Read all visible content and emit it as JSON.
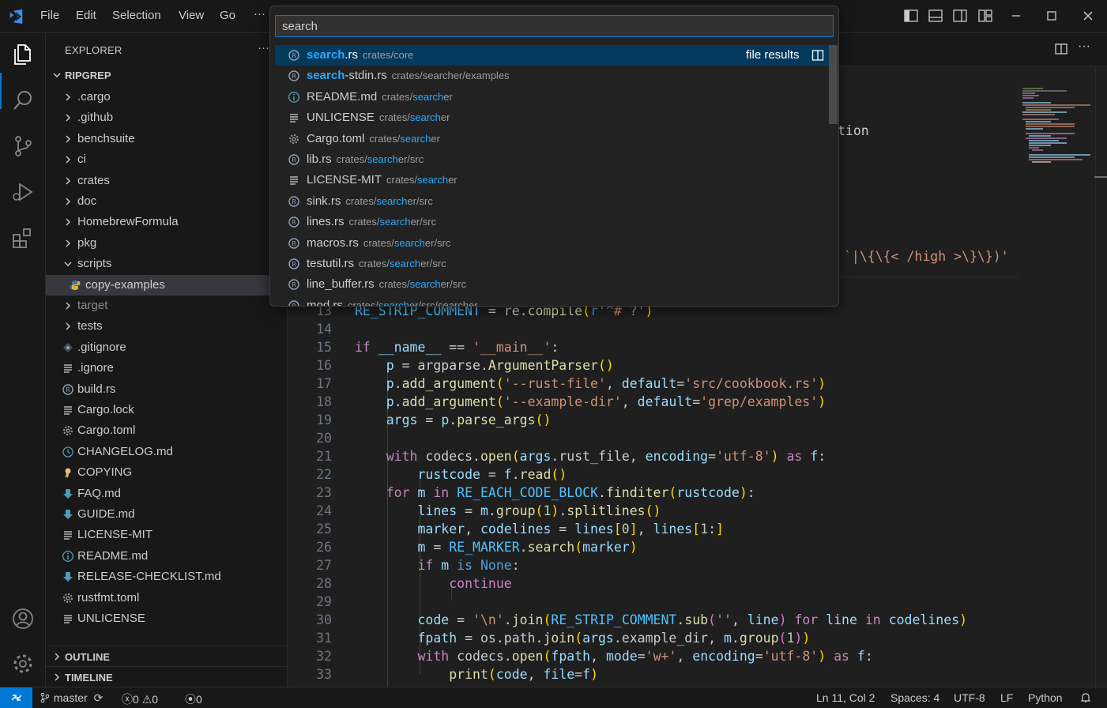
{
  "menu": {
    "file": "File",
    "edit": "Edit",
    "selection": "Selection",
    "view": "View",
    "go": "Go",
    "more": "···"
  },
  "quick_open": {
    "value": "search",
    "active_hint": "file results",
    "results": [
      {
        "icon": "rust-file-icon",
        "prefix": "search",
        "rest": ".rs",
        "path_pre": "crates/core",
        "path_hl": "",
        "path_post": ""
      },
      {
        "icon": "rust-file-icon",
        "prefix": "search",
        "rest": "-stdin.rs",
        "path_pre": "crates/searcher/examples",
        "path_hl": "",
        "path_post": ""
      },
      {
        "icon": "info-icon",
        "prefix": "",
        "rest": "README.md",
        "path_pre": "crates/",
        "path_hl": "search",
        "path_post": "er"
      },
      {
        "icon": "lines-icon",
        "prefix": "",
        "rest": "UNLICENSE",
        "path_pre": "crates/",
        "path_hl": "search",
        "path_post": "er"
      },
      {
        "icon": "gear-icon",
        "prefix": "",
        "rest": "Cargo.toml",
        "path_pre": "crates/",
        "path_hl": "search",
        "path_post": "er"
      },
      {
        "icon": "rust-file-icon",
        "prefix": "",
        "rest": "lib.rs",
        "path_pre": "crates/",
        "path_hl": "search",
        "path_post": "er/src"
      },
      {
        "icon": "lines-icon",
        "prefix": "",
        "rest": "LICENSE-MIT",
        "path_pre": "crates/",
        "path_hl": "search",
        "path_post": "er"
      },
      {
        "icon": "rust-file-icon",
        "prefix": "",
        "rest": "sink.rs",
        "path_pre": "crates/",
        "path_hl": "search",
        "path_post": "er/src"
      },
      {
        "icon": "rust-file-icon",
        "prefix": "",
        "rest": "lines.rs",
        "path_pre": "crates/",
        "path_hl": "search",
        "path_post": "er/src"
      },
      {
        "icon": "rust-file-icon",
        "prefix": "",
        "rest": "macros.rs",
        "path_pre": "crates/",
        "path_hl": "search",
        "path_post": "er/src"
      },
      {
        "icon": "rust-file-icon",
        "prefix": "",
        "rest": "testutil.rs",
        "path_pre": "crates/",
        "path_hl": "search",
        "path_post": "er/src"
      },
      {
        "icon": "rust-file-icon",
        "prefix": "",
        "rest": "line_buffer.rs",
        "path_pre": "crates/",
        "path_hl": "search",
        "path_post": "er/src"
      },
      {
        "icon": "rust-file-icon",
        "prefix": "",
        "rest": "mod.rs",
        "path_pre": "crates/",
        "path_hl": "search",
        "path_post": "er/src/searcher"
      }
    ]
  },
  "explorer": {
    "title": "EXPLORER",
    "more": "···",
    "root": "RIPGREP",
    "items": [
      {
        "label": ".cargo",
        "kind": "folder"
      },
      {
        "label": ".github",
        "kind": "folder"
      },
      {
        "label": "benchsuite",
        "kind": "folder"
      },
      {
        "label": "ci",
        "kind": "folder"
      },
      {
        "label": "crates",
        "kind": "folder"
      },
      {
        "label": "doc",
        "kind": "folder"
      },
      {
        "label": "HomebrewFormula",
        "kind": "folder"
      },
      {
        "label": "pkg",
        "kind": "folder"
      },
      {
        "label": "scripts",
        "kind": "folder-open"
      },
      {
        "label": "copy-examples",
        "kind": "python",
        "selected": true
      },
      {
        "label": "target",
        "kind": "folder",
        "dim": true
      },
      {
        "label": "tests",
        "kind": "folder"
      },
      {
        "label": ".gitignore",
        "kind": "git"
      },
      {
        "label": ".ignore",
        "kind": "lines"
      },
      {
        "label": "build.rs",
        "kind": "rust"
      },
      {
        "label": "Cargo.lock",
        "kind": "lines"
      },
      {
        "label": "Cargo.toml",
        "kind": "gear"
      },
      {
        "label": "CHANGELOG.md",
        "kind": "clock"
      },
      {
        "label": "COPYING",
        "kind": "ribbon"
      },
      {
        "label": "FAQ.md",
        "kind": "download"
      },
      {
        "label": "GUIDE.md",
        "kind": "download"
      },
      {
        "label": "LICENSE-MIT",
        "kind": "lines"
      },
      {
        "label": "README.md",
        "kind": "info"
      },
      {
        "label": "RELEASE-CHECKLIST.md",
        "kind": "download"
      },
      {
        "label": "rustfmt.toml",
        "kind": "gear"
      },
      {
        "label": "UNLICENSE",
        "kind": "lines"
      }
    ],
    "outline": "OUTLINE",
    "timeline": "TIMELINE"
  },
  "editor": {
    "partial_line_top": "tion",
    "partial_line_regex": "`|\\{\\{< /high >\\}\\})'"
  },
  "status": {
    "branch": "master",
    "errors": "0",
    "warnings": "0",
    "ports": "0",
    "position": "Ln 11, Col 2",
    "spaces": "Spaces: 4",
    "encoding": "UTF-8",
    "eol": "LF",
    "language": "Python"
  },
  "colors": {
    "accent": "#0078d4",
    "highlight": "#2aaaff",
    "selected_row": "#04395e"
  }
}
